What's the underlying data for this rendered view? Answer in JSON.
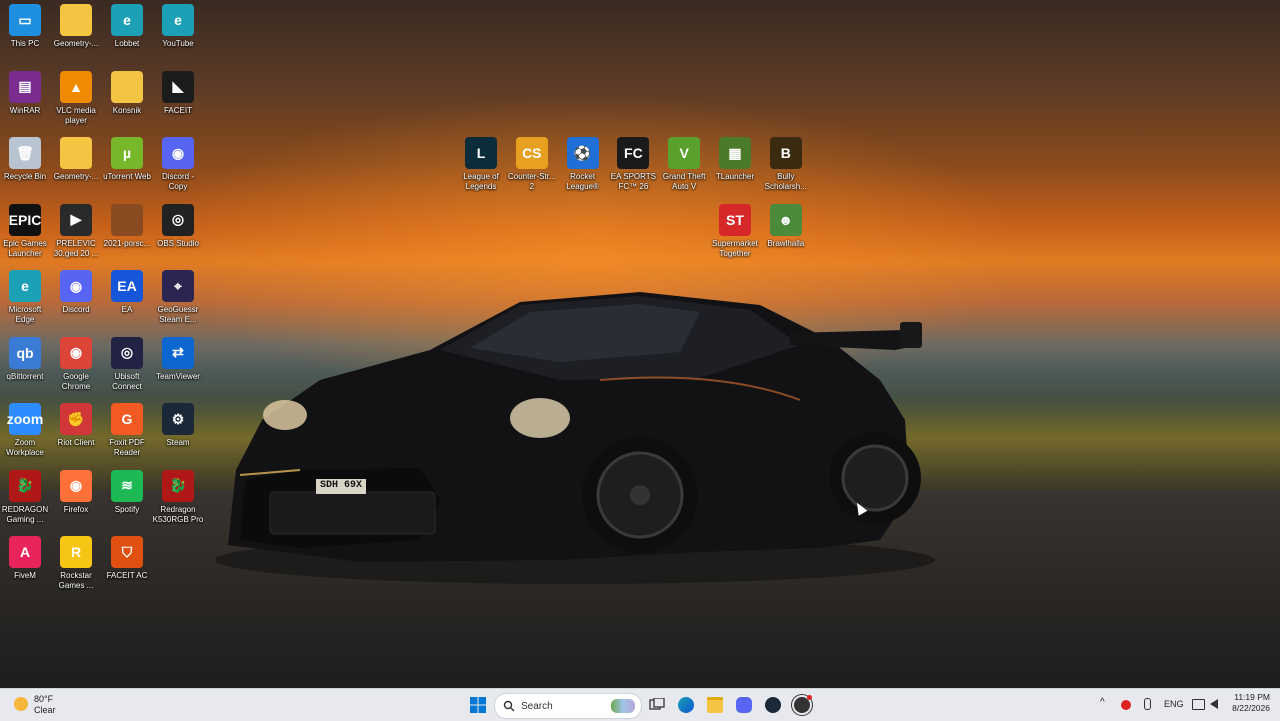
{
  "desktop_icons": [
    {
      "label": "This PC",
      "icon": "this-pc-icon",
      "color": "#1f8fe0",
      "glyph": "▭"
    },
    {
      "label": "Geometry-...",
      "icon": "folder-icon",
      "color": "#f4c542",
      "glyph": ""
    },
    {
      "label": "Lobbet",
      "icon": "edge-icon",
      "color": "#1ca0b5",
      "glyph": "e"
    },
    {
      "label": "YouTube",
      "icon": "edge-icon",
      "color": "#1ca0b5",
      "glyph": "e"
    },
    {
      "label": "WinRAR",
      "icon": "winrar-icon",
      "color": "#7a2d8f",
      "glyph": "▤"
    },
    {
      "label": "VLC media player",
      "icon": "vlc-icon",
      "color": "#f08a00",
      "glyph": "▲"
    },
    {
      "label": "Konsnik",
      "icon": "folder-icon",
      "color": "#f4c542",
      "glyph": ""
    },
    {
      "label": "FACEIT",
      "icon": "faceit-icon",
      "color": "#1c1c1c",
      "glyph": "◣"
    },
    {
      "label": "Recycle Bin",
      "icon": "recycle-bin-icon",
      "color": "#b8c4d0",
      "glyph": "🗑"
    },
    {
      "label": "Geometry-...",
      "icon": "folder-icon",
      "color": "#f4c542",
      "glyph": ""
    },
    {
      "label": "uTorrent Web",
      "icon": "utorrent-icon",
      "color": "#76b82a",
      "glyph": "µ"
    },
    {
      "label": "Discord - Copy",
      "icon": "discord-icon",
      "color": "#5865f2",
      "glyph": "◉"
    },
    {
      "label": "Epic Games Launcher",
      "icon": "epic-games-icon",
      "color": "#111111",
      "glyph": "EPIC"
    },
    {
      "label": "PRELEVIC 30.ged 20 ...",
      "icon": "video-file-icon",
      "color": "#2a2a2a",
      "glyph": "▶"
    },
    {
      "label": "2021-porsc...",
      "icon": "image-file-icon",
      "color": "#8a4a22",
      "glyph": ""
    },
    {
      "label": "OBS Studio",
      "icon": "obs-icon",
      "color": "#222222",
      "glyph": "◎"
    },
    {
      "label": "Microsoft Edge",
      "icon": "edge-icon",
      "color": "#1ca0b5",
      "glyph": "e"
    },
    {
      "label": "Discord",
      "icon": "discord-icon",
      "color": "#5865f2",
      "glyph": "◉"
    },
    {
      "label": "EA",
      "icon": "ea-icon",
      "color": "#1656d8",
      "glyph": "EA"
    },
    {
      "label": "GeoGuessr Steam E...",
      "icon": "geoguessr-icon",
      "color": "#2b2552",
      "glyph": "⌖"
    },
    {
      "label": "qBittorrent",
      "icon": "qbittorrent-icon",
      "color": "#3a7bd5",
      "glyph": "qb"
    },
    {
      "label": "Google Chrome",
      "icon": "chrome-icon",
      "color": "#db4437",
      "glyph": "◉"
    },
    {
      "label": "Ubisoft Connect",
      "icon": "ubisoft-icon",
      "color": "#222244",
      "glyph": "◎"
    },
    {
      "label": "TeamViewer",
      "icon": "teamviewer-icon",
      "color": "#0e66d0",
      "glyph": "⇄"
    },
    {
      "label": "Zoom Workplace",
      "icon": "zoom-icon",
      "color": "#2d8cff",
      "glyph": "zoom"
    },
    {
      "label": "Riot Client",
      "icon": "riot-icon",
      "color": "#d13639",
      "glyph": "✊"
    },
    {
      "label": "Foxit PDF Reader",
      "icon": "foxit-icon",
      "color": "#f15a22",
      "glyph": "G"
    },
    {
      "label": "Steam",
      "icon": "steam-icon",
      "color": "#1b2838",
      "glyph": "⚙"
    },
    {
      "label": "REDRAGON Gaming ...",
      "icon": "redragon-icon",
      "color": "#b01818",
      "glyph": "🐉"
    },
    {
      "label": "Firefox",
      "icon": "firefox-icon",
      "color": "#ff7139",
      "glyph": "◉"
    },
    {
      "label": "Spotify",
      "icon": "spotify-icon",
      "color": "#1db954",
      "glyph": "≋"
    },
    {
      "label": "Redragon K530RGB Pro",
      "icon": "redragon-icon",
      "color": "#b01818",
      "glyph": "🐉"
    },
    {
      "label": "FiveM",
      "icon": "fivem-icon",
      "color": "#e8245a",
      "glyph": "A"
    },
    {
      "label": "Rockstar Games ...",
      "icon": "rockstar-icon",
      "color": "#f7c514",
      "glyph": "R"
    },
    {
      "label": "FACEIT AC",
      "icon": "faceit-ac-icon",
      "color": "#e05010",
      "glyph": "⛉"
    }
  ],
  "game_icons": [
    {
      "label": "League of Legends",
      "icon": "league-of-legends-icon",
      "color": "#0b2c3a",
      "glyph": "L"
    },
    {
      "label": "Counter-Str... 2",
      "icon": "counter-strike-icon",
      "color": "#e8a020",
      "glyph": "CS"
    },
    {
      "label": "Rocket League®",
      "icon": "rocket-league-icon",
      "color": "#1f6fd6",
      "glyph": "⚽"
    },
    {
      "label": "EA SPORTS FC™ 26",
      "icon": "ea-fc-icon",
      "color": "#1a1a1a",
      "glyph": "FC"
    },
    {
      "label": "Grand Theft Auto V",
      "icon": "gta-v-icon",
      "color": "#5aa02c",
      "glyph": "V"
    },
    {
      "label": "TLauncher",
      "icon": "tlauncher-icon",
      "color": "#4a7a2a",
      "glyph": "▦"
    },
    {
      "label": "Bully Scholarsh...",
      "icon": "bully-icon",
      "color": "#3a2a10",
      "glyph": "B"
    },
    {
      "label": "Supermarket Together",
      "icon": "supermarket-together-icon",
      "color": "#d62828",
      "glyph": "ST"
    },
    {
      "label": "Brawlhalla",
      "icon": "brawlhalla-icon",
      "color": "#4a8a3a",
      "glyph": "☻"
    }
  ],
  "car": {
    "plate": "SDH 69X"
  },
  "taskbar": {
    "weather_temp": "80°F",
    "weather_desc": "Clear",
    "search_placeholder": "Search",
    "language": "ENG",
    "time": "11:19 PM",
    "date": "8/22/2026"
  },
  "colors": {
    "taskbar_bg": "#e7e9ee",
    "windows_blue": "#0078d4"
  }
}
